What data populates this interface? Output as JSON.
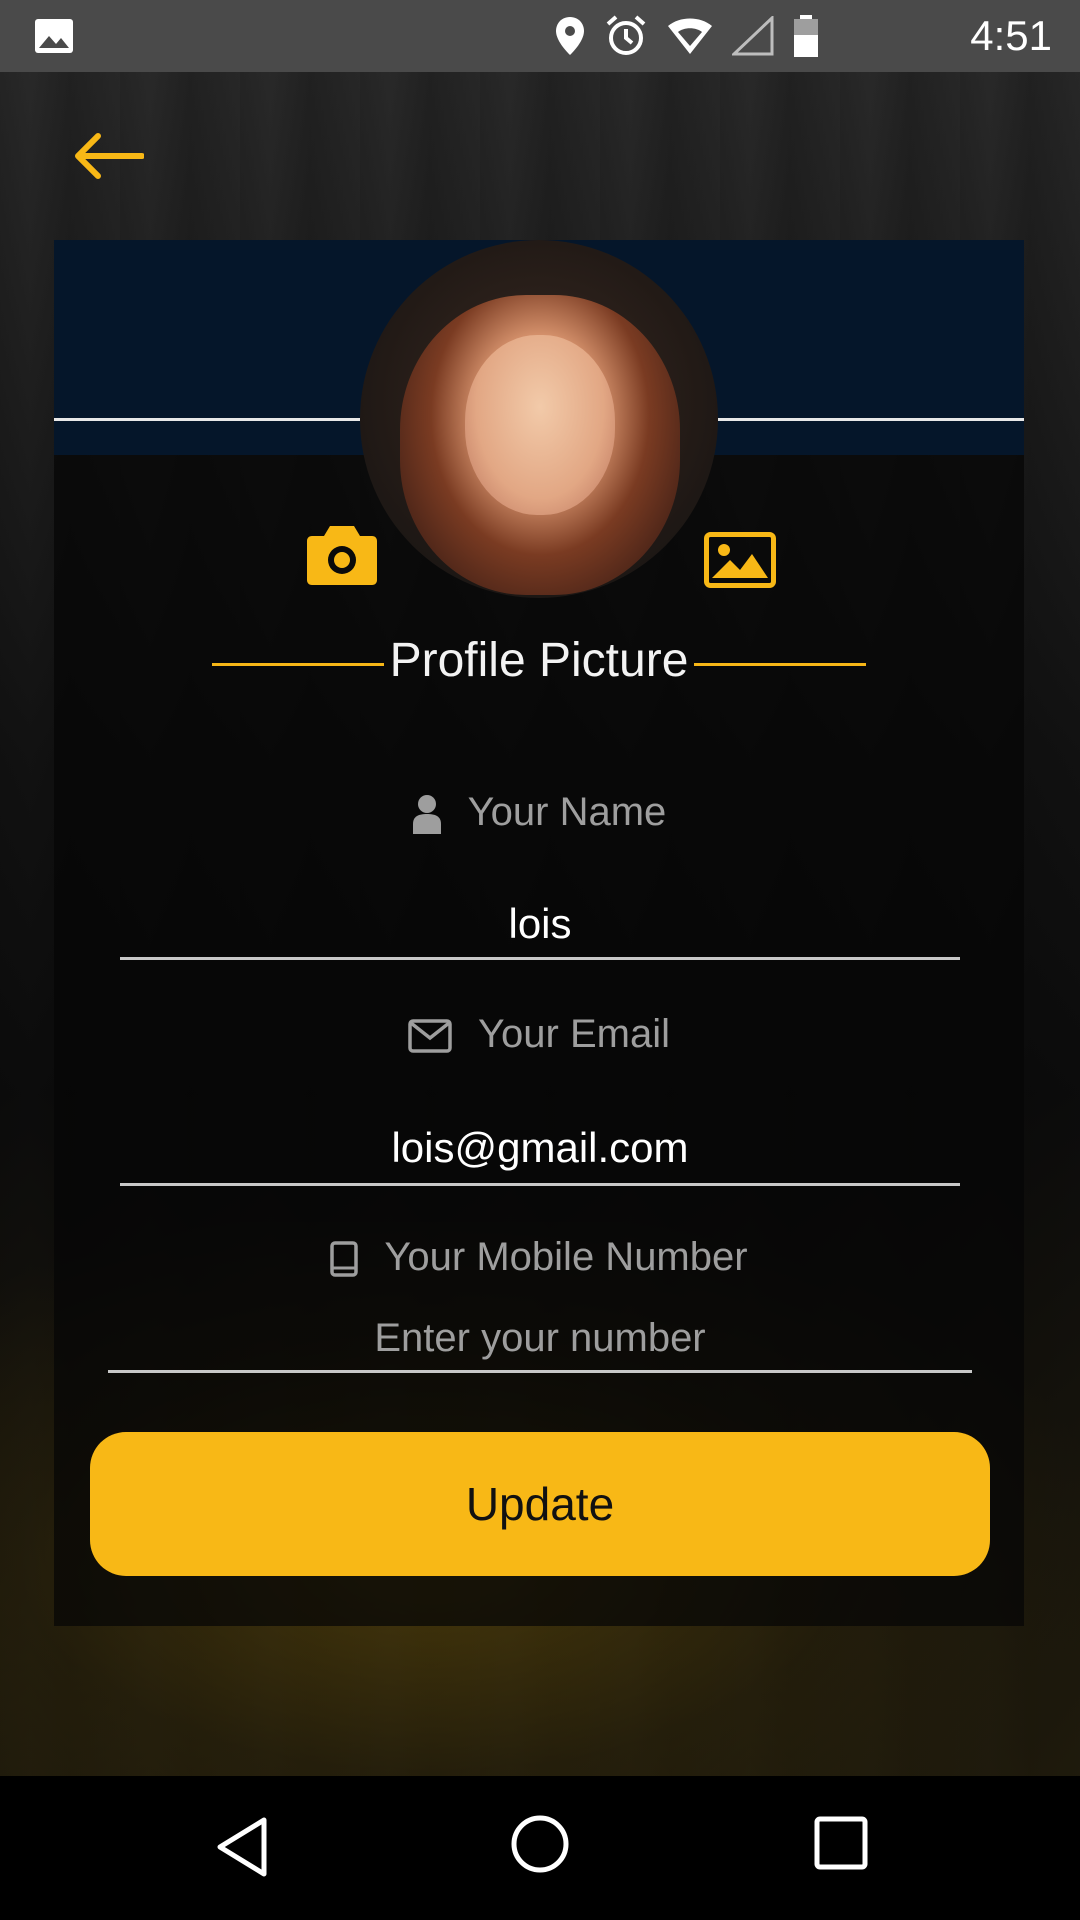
{
  "status_bar": {
    "time": "4:51",
    "icons": [
      "gallery-icon",
      "location-icon",
      "alarm-icon",
      "wifi-icon",
      "signal-icon",
      "battery-icon"
    ]
  },
  "colors": {
    "accent": "#f8b816",
    "header": "#05162a",
    "label": "#9e9e9e"
  },
  "profile": {
    "title": "Profile Picture",
    "camera_icon": "camera-icon",
    "gallery_icon": "image-icon"
  },
  "form": {
    "name": {
      "label": "Your Name",
      "value": "lois",
      "icon": "user-icon"
    },
    "email": {
      "label": "Your Email",
      "value": "lois@gmail.com",
      "icon": "envelope-icon"
    },
    "mobile": {
      "label": "Your Mobile Number",
      "placeholder": "Enter your number",
      "icon": "phone-icon"
    }
  },
  "update_label": "Update",
  "nav_bar": {
    "icons": [
      "back-icon",
      "home-icon",
      "recents-icon"
    ]
  }
}
